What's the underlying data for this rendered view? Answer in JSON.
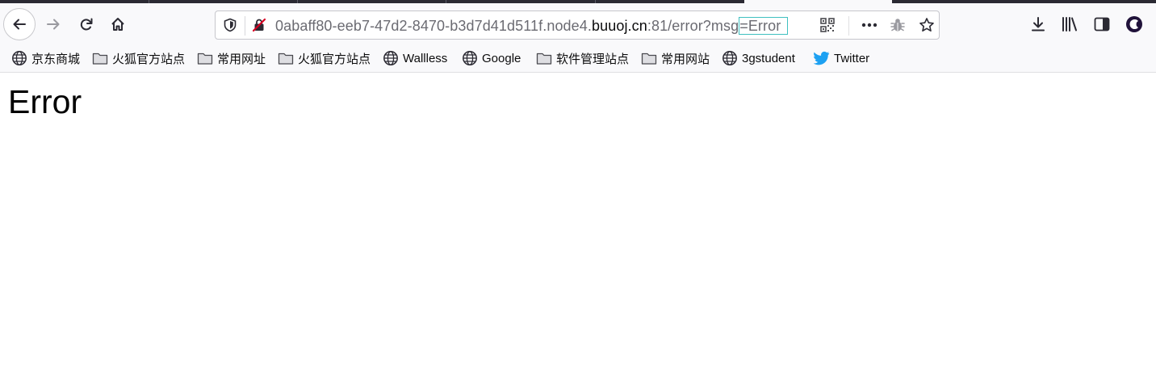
{
  "browser": {
    "url": {
      "prefix": "0abaff80-eeb7-47d2-8470-b3d7d41d511f.node4.",
      "host": "buuoj.cn",
      "path": ":81/error?msg",
      "highlight": "=Error"
    },
    "bookmarks": [
      {
        "label": "京东商城",
        "icon": "globe-icon"
      },
      {
        "label": "火狐官方站点",
        "icon": "folder-icon"
      },
      {
        "label": "常用网址",
        "icon": "folder-icon"
      },
      {
        "label": "火狐官方站点",
        "icon": "folder-icon"
      },
      {
        "label": "Wallless",
        "icon": "globe-icon"
      },
      {
        "label": "Google",
        "icon": "globe-icon"
      },
      {
        "label": "软件管理站点",
        "icon": "folder-icon"
      },
      {
        "label": "常用网站",
        "icon": "folder-icon"
      },
      {
        "label": "3gstudent",
        "icon": "globe-icon"
      },
      {
        "label": "Twitter",
        "icon": "twitter-bird-icon"
      }
    ]
  },
  "page": {
    "heading": "Error"
  },
  "colors": {
    "accent_highlight": "#3fc0c0",
    "tracking_slash": "#d70022",
    "twitter": "#1da1f2"
  }
}
